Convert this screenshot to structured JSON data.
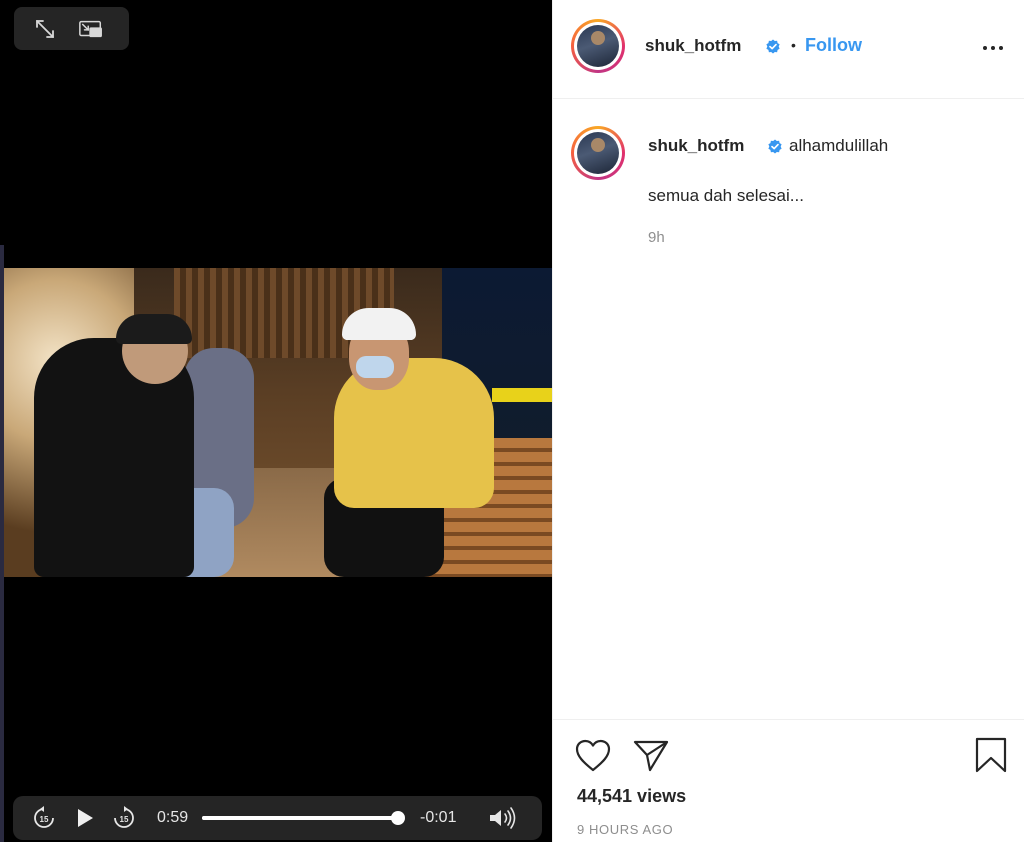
{
  "video": {
    "current_time": "0:59",
    "remaining_time": "-0:01",
    "progress": 0.98,
    "skip_back_seconds": "15",
    "skip_forward_seconds": "15"
  },
  "post": {
    "header": {
      "username": "shuk_hotfm",
      "separator": "•",
      "follow_label": "Follow"
    },
    "caption": {
      "username": "shuk_hotfm",
      "text": "alhamdulillah",
      "line2": "semua dah selesai...",
      "time_ago": "9h"
    },
    "stats": {
      "views": "44,541 views",
      "posted": "9 HOURS AGO"
    }
  },
  "colors": {
    "accent": "#3897f0",
    "verified": "#3897f0",
    "text": "#262626",
    "muted": "#8e8e8e"
  },
  "icons": [
    "expand-icon",
    "picture-in-picture-icon",
    "rewind-15-icon",
    "play-icon",
    "forward-15-icon",
    "volume-icon",
    "verified-icon",
    "more-options-icon",
    "heart-icon",
    "share-icon",
    "bookmark-icon"
  ]
}
